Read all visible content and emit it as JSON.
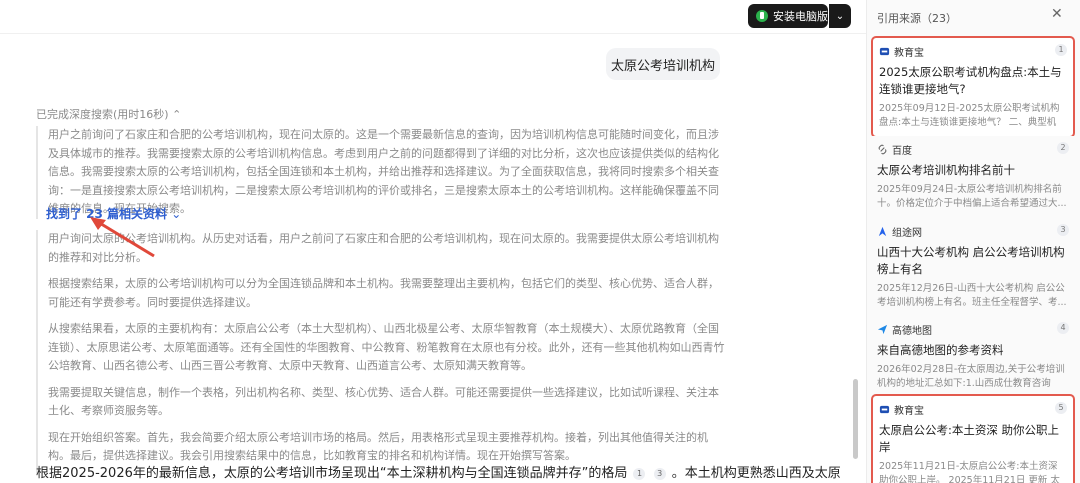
{
  "topbar": {
    "install_label": "安装电脑版",
    "dropdown_glyph": "⌄"
  },
  "chat": {
    "user_message": "太原公考培训机构",
    "deep_search_status": "已完成深度搜索(用时16秒)",
    "thinking_block1": "用户之前询问了石家庄和合肥的公考培训机构，现在问太原的。这是一个需要最新信息的查询，因为培训机构信息可能随时间变化，而且涉及具体城市的推荐。我需要搜索太原的公考培训机构信息。考虑到用户之前的问题都得到了详细的对比分析，这次也应该提供类似的结构化信息。我需要搜索太原的公考培训机构，包括全国连锁和本土机构，并给出推荐和选择建议。为了全面获取信息，我将同时搜索多个相关查询：一是直接搜索太原公考培训机构，二是搜索太原公考培训机构的评价或排名，三是搜索太原本土的公考培训机构。这样能确保覆盖不同维度的信息。现在开始搜索。",
    "found_link": "找到了 23 篇相关资料",
    "thinking_paragraphs": [
      "用户询问太原的公考培训机构。从历史对话看，用户之前问了石家庄和合肥的公考培训机构，现在问太原的。我需要提供太原公考培训机构的推荐和对比分析。",
      "根据搜索结果，太原的公考培训机构可以分为全国连锁品牌和本土机构。我需要整理出主要机构，包括它们的类型、核心优势、适合人群，可能还有学费参考。同时要提供选择建议。",
      "从搜索结果看，太原的主要机构有：太原启公公考（本土大型机构）、山西北极星公考、太原华智教育（本土规模大）、太原优路教育（全国连锁）、太原思诺公考、太原笔面通等。还有全国性的华图教育、中公教育、粉笔教育在太原也有分校。此外，还有一些其他机构如山西青竹公培教育、山西名德公考、山西三晋公考教育、太原中天教育、山西道言公考、太原知满天教育等。",
      "我需要提取关键信息，制作一个表格，列出机构名称、类型、核心优势、适合人群。可能还需要提供一些选择建议，比如试听课程、关注本土化、考察师资服务等。",
      "现在开始组织答案。首先，我会简要介绍太原公考培训市场的格局。然后，用表格形式呈现主要推荐机构。接着，列出其他值得关注的机构。最后，提供选择建议。我会引用搜索结果中的信息，比如教育宝的排名和机构详情。现在开始撰写答案。"
    ],
    "answer_prefix": "根据2025-2026年的最新信息，太原的公考培训市场呈现出“本土深耕机构与全国连锁品牌并存”的格局",
    "answer_cite1": "1",
    "answer_cite2": "3",
    "answer_suffix": "。本土机构更熟悉山西及太原"
  },
  "sidebar": {
    "title": "引用来源（23）",
    "close_glyph": "✕",
    "cards": [
      {
        "source": "教育宝",
        "num": "1",
        "title": "2025太原公职考试机构盘点:本土与连锁谁更接地气?",
        "snippet": "2025年09月12日-2025太原公职考试机构盘点:本土与连锁谁更接地气？ 二、典型机构...",
        "icon": "jiaoyubao-icon",
        "color": "#1f4fb3"
      },
      {
        "source": "百度",
        "num": "2",
        "title": "太原公考培训机构排名前十",
        "snippet": "2025年09月24日-太原公考培训机构排名前十。价格定位介于中档偏上适合希望通过大...",
        "icon": "link-icon",
        "color": "#666666"
      },
      {
        "source": "组途网",
        "num": "3",
        "title": "山西十大公考机构 启公公考培训机构榜上有名",
        "snippet": "2025年12月26日-山西十大公考机构 启公公考培训机构榜上有名。班主任全程督学、考...",
        "icon": "zutu-icon",
        "color": "#2563eb"
      },
      {
        "source": "高德地图",
        "num": "4",
        "title": "来自高德地图的参考资料",
        "snippet": "2026年02月28日-在太原周边,关于公考培训机构的地址汇总如下:1.山西成仕教育咨询有...",
        "icon": "amap-icon",
        "color": "#1e88e5"
      },
      {
        "source": "教育宝",
        "num": "5",
        "title": "太原启公公考:本土资深 助你公职上岸",
        "snippet": "2025年11月21日-太原启公公考:本土资深 助你公职上岸。 2025年11月21日 更新 太原启...",
        "icon": "jiaoyubao-icon",
        "color": "#1f4fb3"
      }
    ]
  }
}
